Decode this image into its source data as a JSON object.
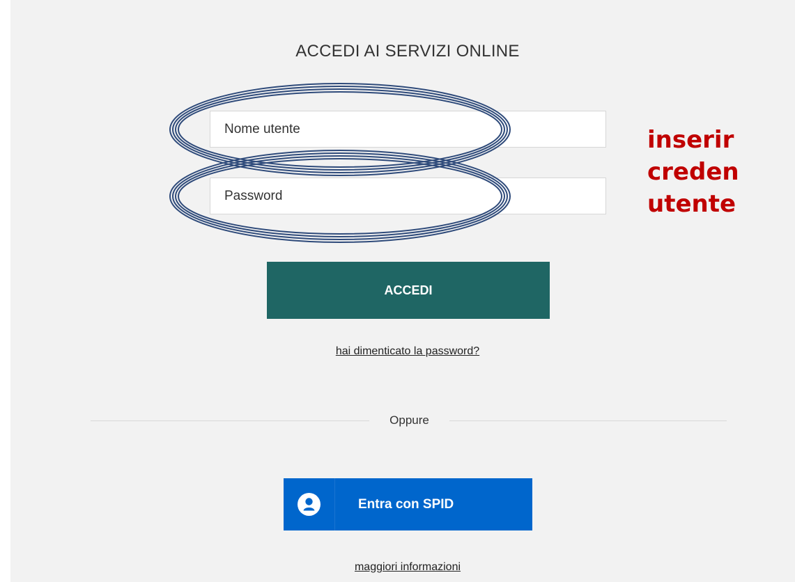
{
  "login": {
    "title": "ACCEDI AI SERVIZI ONLINE",
    "username_placeholder": "Nome utente",
    "password_placeholder": "Password",
    "submit_label": "ACCEDI",
    "forgot_link": "hai dimenticato la password?",
    "divider_label": "Oppure",
    "spid_label": "Entra con SPID",
    "more_info_link": "maggiori informazioni"
  },
  "annotation": {
    "lines": [
      "inserir",
      "creden",
      "utente"
    ],
    "color": "#c00000",
    "ellipse_color": "#2e4a7a"
  },
  "colors": {
    "panel_background": "#f2f2f2",
    "login_button": "#1f6664",
    "spid_button": "#0066cc"
  },
  "icons": {
    "spid": "user-circle-icon"
  }
}
